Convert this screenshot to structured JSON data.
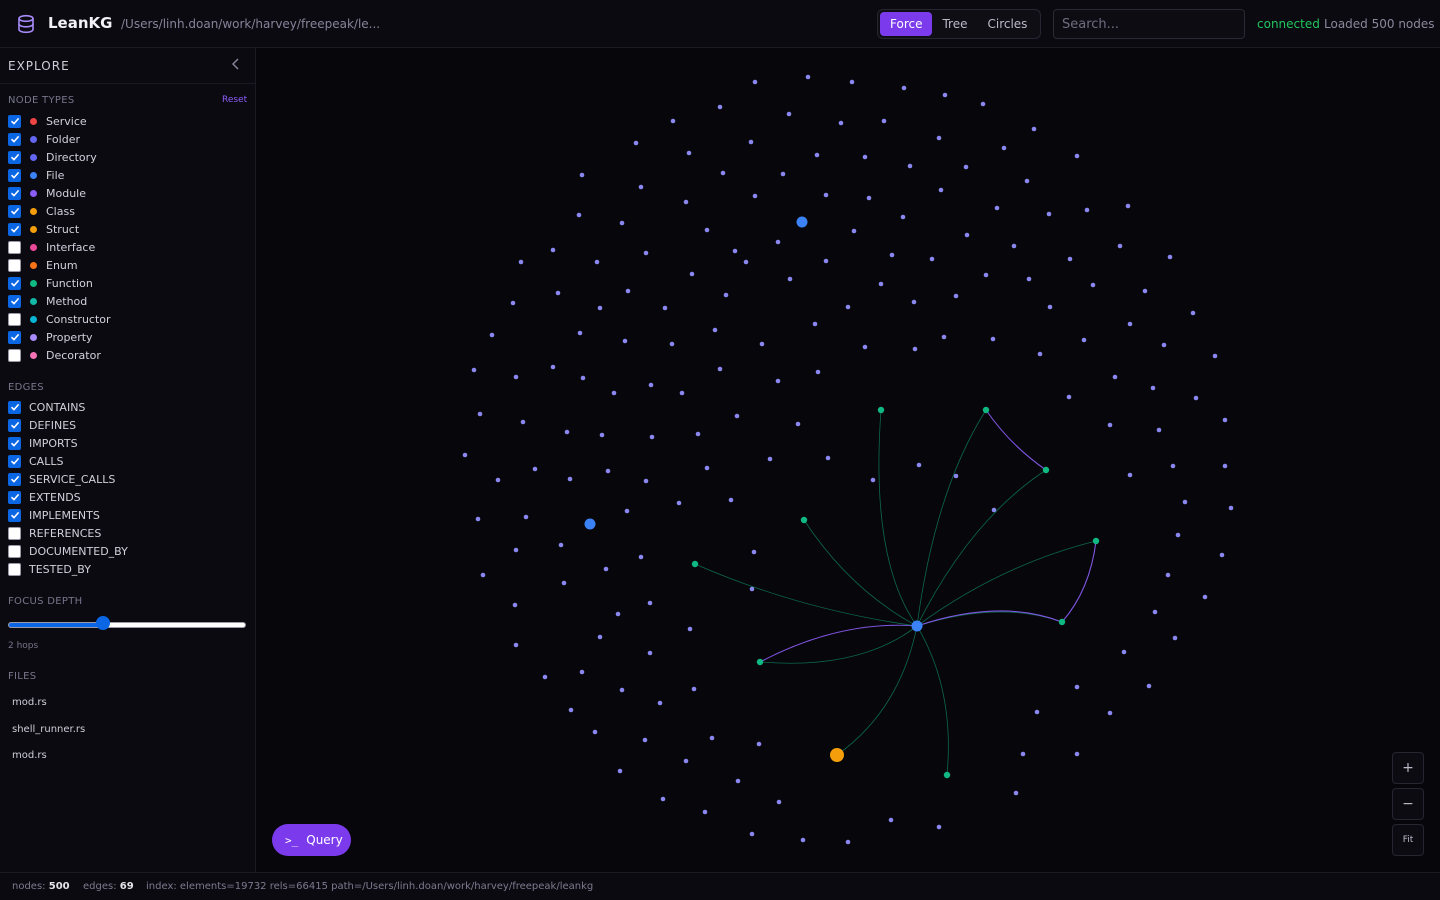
{
  "header": {
    "app_title": "LeanKG",
    "path": "/Users/linh.doan/work/harvey/freepeak/le...",
    "layout_tabs": [
      {
        "label": "Force",
        "active": true
      },
      {
        "label": "Tree",
        "active": false
      },
      {
        "label": "Circles",
        "active": false
      }
    ],
    "search_placeholder": "Search...",
    "search_value": "",
    "status": "connected",
    "loaded": "Loaded 500 nodes"
  },
  "sidebar": {
    "title": "EXPLORE",
    "collapse_icon": "chevron-left-icon",
    "node_types_label": "NODE TYPES",
    "reset_label": "Reset",
    "node_types": [
      {
        "label": "Service",
        "checked": true,
        "color": "#ef4444"
      },
      {
        "label": "Folder",
        "checked": true,
        "color": "#6366f1"
      },
      {
        "label": "Directory",
        "checked": true,
        "color": "#6366f1"
      },
      {
        "label": "File",
        "checked": true,
        "color": "#3b82f6"
      },
      {
        "label": "Module",
        "checked": true,
        "color": "#8b5cf6"
      },
      {
        "label": "Class",
        "checked": true,
        "color": "#f59e0b"
      },
      {
        "label": "Struct",
        "checked": true,
        "color": "#f59e0b"
      },
      {
        "label": "Interface",
        "checked": false,
        "color": "#ec4899"
      },
      {
        "label": "Enum",
        "checked": false,
        "color": "#f97316"
      },
      {
        "label": "Function",
        "checked": true,
        "color": "#10b981"
      },
      {
        "label": "Method",
        "checked": true,
        "color": "#14b8a6"
      },
      {
        "label": "Constructor",
        "checked": false,
        "color": "#06b6d4"
      },
      {
        "label": "Property",
        "checked": true,
        "color": "#a78bfa"
      },
      {
        "label": "Decorator",
        "checked": false,
        "color": "#f472b6"
      }
    ],
    "edges_label": "EDGES",
    "edges": [
      {
        "label": "CONTAINS",
        "checked": true
      },
      {
        "label": "DEFINES",
        "checked": true
      },
      {
        "label": "IMPORTS",
        "checked": true
      },
      {
        "label": "CALLS",
        "checked": true
      },
      {
        "label": "SERVICE_CALLS",
        "checked": true
      },
      {
        "label": "EXTENDS",
        "checked": true
      },
      {
        "label": "IMPLEMENTS",
        "checked": true
      },
      {
        "label": "REFERENCES",
        "checked": false
      },
      {
        "label": "DOCUMENTED_BY",
        "checked": false
      },
      {
        "label": "TESTED_BY",
        "checked": false
      }
    ],
    "focus_depth_label": "FOCUS DEPTH",
    "focus_depth_fraction": 0.4,
    "focus_depth_text": "2 hops",
    "files_label": "FILES",
    "files": [
      "mod.rs",
      "shell_runner.rs",
      "mod.rs"
    ]
  },
  "graph": {
    "query_label": "Query",
    "query_icon": "terminal-icon",
    "zoom_in": "+",
    "zoom_out": "−",
    "fit": "Fit"
  },
  "footer": {
    "nodes_label": "nodes:",
    "nodes": "500",
    "edges_label": "edges:",
    "edges": "69",
    "index": "index: elements=19732 rels=66415 path=/Users/linh.doan/work/harvey/freepeak/leankg"
  },
  "colors": {
    "accent": "#7c3aed",
    "connected": "#22c55e",
    "node_default": "#8b87f0",
    "node_function": "#10b981",
    "node_file": "#3b82f6",
    "node_struct": "#f59e0b",
    "edge_calls": "#10b981",
    "edge_other": "#8b5cf6"
  }
}
